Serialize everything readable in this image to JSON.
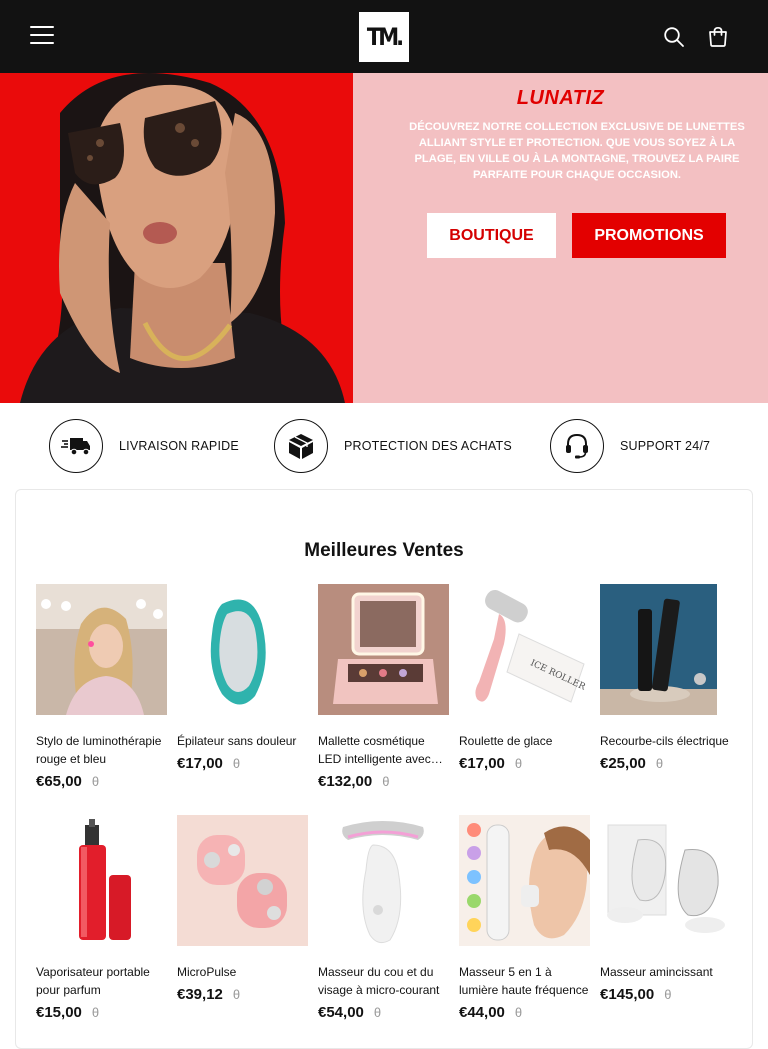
{
  "header": {
    "logo_text": "TM."
  },
  "hero": {
    "title": "LUNATIZ",
    "text": "DÉCOUVREZ NOTRE COLLECTION EXCLUSIVE DE LUNETTES ALLIANT STYLE ET PROTECTION. QUE VOUS SOYEZ À LA PLAGE, EN VILLE OU À LA MONTAGNE, TROUVEZ LA PAIRE PARFAITE POUR CHAQUE OCCASION.",
    "button_boutique": "BOUTIQUE",
    "button_promotions": "PROMOTIONS"
  },
  "features": [
    {
      "label": "LIVRAISON RAPIDE",
      "icon": "truck-icon"
    },
    {
      "label": "PROTECTION DES ACHATS",
      "icon": "box-icon"
    },
    {
      "label": "SUPPORT  24/7",
      "icon": "headset-icon"
    }
  ],
  "best_sellers": {
    "title": "Meilleures Ventes",
    "currency_symbol": "θ",
    "products": [
      {
        "name": "Stylo de luminothérapie rouge et bleu",
        "price": "€65,00"
      },
      {
        "name": "Épilateur sans douleur",
        "price": "€17,00"
      },
      {
        "name": "Mallette cosmétique LED intelligente avec…",
        "price": "€132,00"
      },
      {
        "name": "Roulette de glace",
        "price": "€17,00"
      },
      {
        "name": "Recourbe-cils électrique",
        "price": "€25,00"
      },
      {
        "name": "Vaporisateur portable pour parfum",
        "price": "€15,00"
      },
      {
        "name": "MicroPulse",
        "price": "€39,12"
      },
      {
        "name": "Masseur du cou et du visage à micro-courant",
        "price": "€54,00"
      },
      {
        "name": "Masseur 5 en 1 à lumière haute fréquence",
        "price": "€44,00"
      },
      {
        "name": "Masseur amincissant",
        "price": "€145,00"
      }
    ]
  },
  "colors": {
    "header_bg": "#121212",
    "hero_red": "#ea0b0b",
    "hero_pink": "#f3c0c2",
    "accent_red": "#e30000"
  }
}
